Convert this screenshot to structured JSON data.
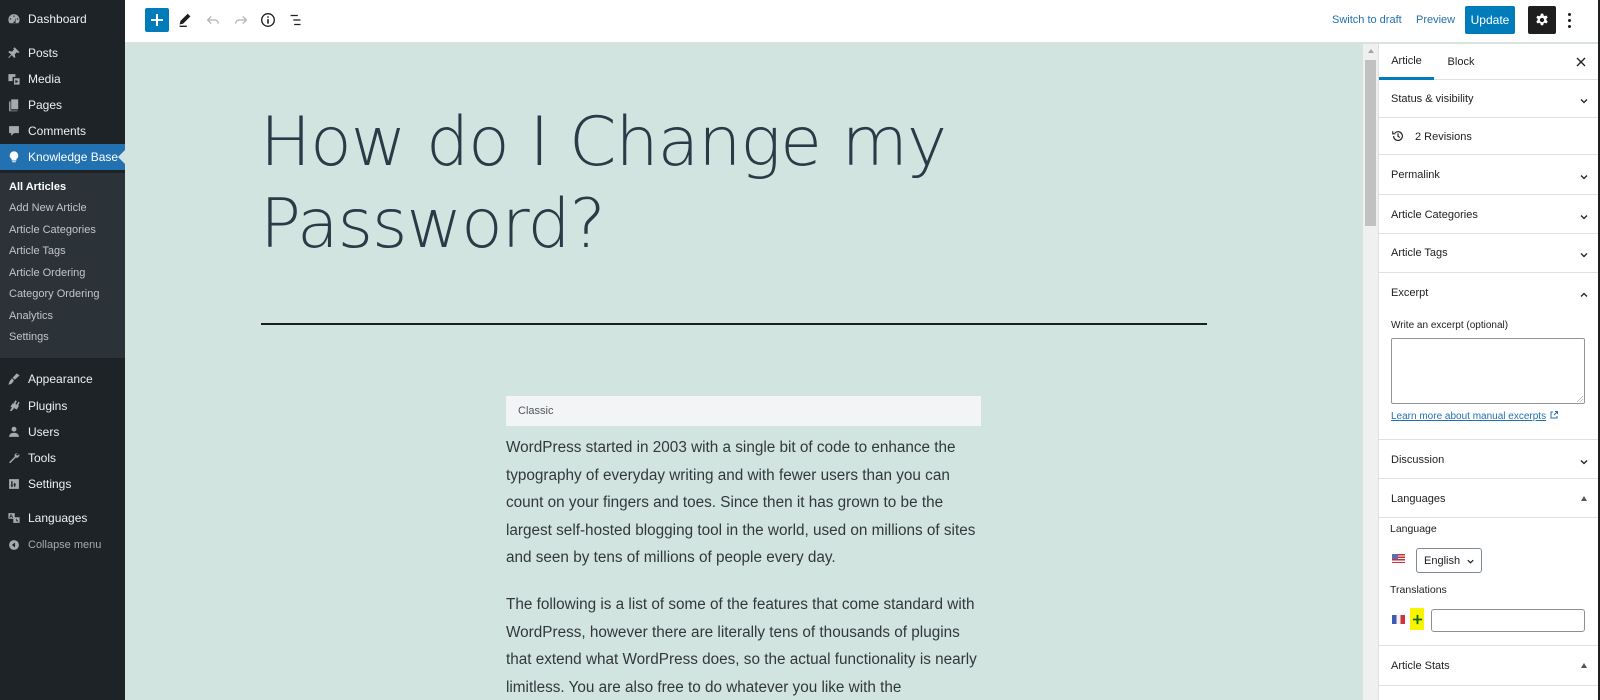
{
  "admin_menu": {
    "items": [
      {
        "label": "Dashboard",
        "icon": "dashboard-icon"
      },
      {
        "label": "Posts",
        "icon": "pin-icon"
      },
      {
        "label": "Media",
        "icon": "media-icon"
      },
      {
        "label": "Pages",
        "icon": "pages-icon"
      },
      {
        "label": "Comments",
        "icon": "comment-icon"
      },
      {
        "label": "Knowledge Base",
        "icon": "lightbulb-icon",
        "active": true
      }
    ],
    "submenu": [
      {
        "label": "All Articles",
        "current": true
      },
      {
        "label": "Add New Article"
      },
      {
        "label": "Article Categories"
      },
      {
        "label": "Article Tags"
      },
      {
        "label": "Article Ordering"
      },
      {
        "label": "Category Ordering"
      },
      {
        "label": "Analytics"
      },
      {
        "label": "Settings"
      }
    ],
    "lower_items": [
      {
        "label": "Appearance",
        "icon": "brush-icon"
      },
      {
        "label": "Plugins",
        "icon": "plugin-icon"
      },
      {
        "label": "Users",
        "icon": "user-icon"
      },
      {
        "label": "Tools",
        "icon": "wrench-icon"
      },
      {
        "label": "Settings",
        "icon": "settings-icon"
      },
      {
        "label": "Languages",
        "icon": "translate-icon"
      }
    ],
    "collapse_label": "Collapse menu"
  },
  "toolbar": {
    "switch_to_draft": "Switch to draft",
    "preview": "Preview",
    "update": "Update",
    "accent": "#007cba"
  },
  "editor": {
    "title": "How do I Change my Password?",
    "classic_block_label": "Classic",
    "paragraphs": [
      "WordPress started in 2003 with a single bit of code to enhance the typography of everyday writing and with fewer users than you can count on your fingers and toes. Since then it has grown to be the largest self-hosted blogging tool in the world, used on millions of sites and seen by tens of millions of people every day.",
      "The following is a list of some of the features that come standard with WordPress, however there are literally tens of thousands of plugins that extend what WordPress does, so the actual functionality is nearly limitless. You are also free to do whatever you like with the"
    ],
    "background": "#d2e4df"
  },
  "settings_sidebar": {
    "tabs": [
      {
        "label": "Article",
        "active": true
      },
      {
        "label": "Block"
      }
    ],
    "panels": {
      "status_visibility": "Status & visibility",
      "revisions": "2 Revisions",
      "permalink": "Permalink",
      "article_categories": "Article Categories",
      "article_tags": "Article Tags",
      "excerpt": "Excerpt",
      "discussion": "Discussion",
      "languages": "Languages",
      "article_stats": "Article Stats"
    },
    "excerpt": {
      "label": "Write an excerpt (optional)",
      "value": "",
      "link": "Learn more about manual excerpts"
    },
    "languages": {
      "language_label": "Language",
      "selected_language": "English",
      "translations_label": "Translations",
      "translation_value": ""
    }
  }
}
